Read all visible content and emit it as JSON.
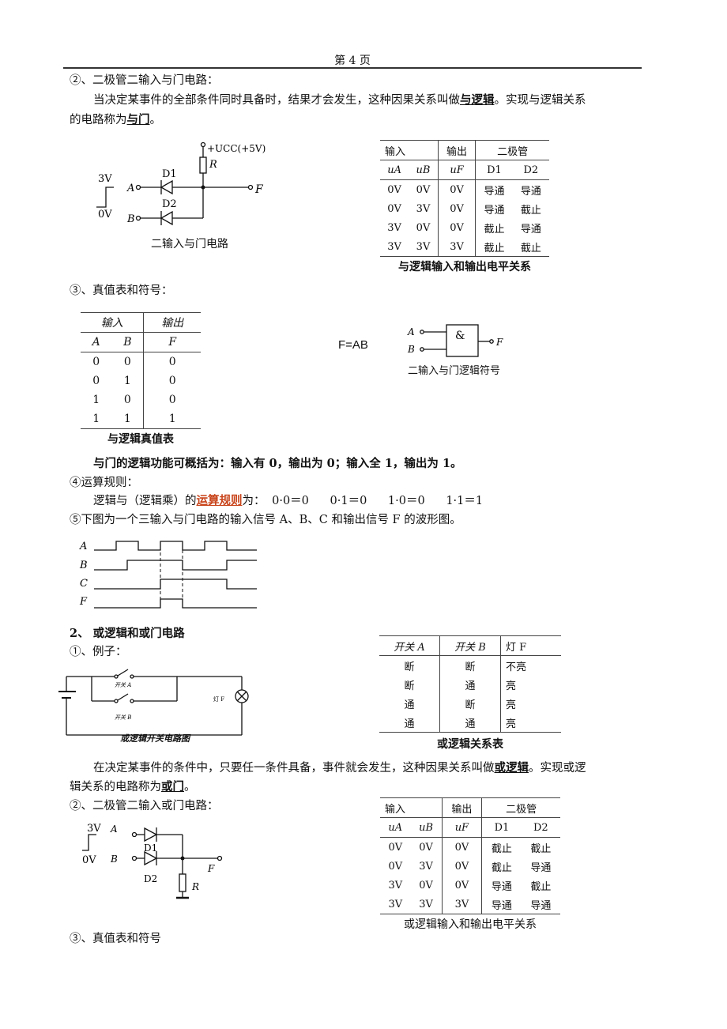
{
  "header": {
    "page_label": "第 4 页"
  },
  "and_section": {
    "item2_heading": "②、二极管二输入与门电路：",
    "para1_a": "当决定某事件的全部条件同时具备时，结果才会发生，这种因果关系叫做",
    "para1_term": "与逻辑",
    "para1_b": "。实现与逻辑关系",
    "para2_a": "的电路称为",
    "para2_term": "与门",
    "para2_b": "。",
    "circuit": {
      "caption": "二输入与门电路",
      "vcc_label": "+UCC(+5V)",
      "r_label": "R",
      "d1_label": "D1",
      "d2_label": "D2",
      "input_a": "A",
      "input_b": "B",
      "output_f": "F",
      "high_level": "3V",
      "low_level": "0V"
    },
    "level_table": {
      "headers": [
        "输入",
        "输出",
        "二极管"
      ],
      "subheaders": [
        "uA",
        "uB",
        "uF",
        "D1",
        "D2"
      ],
      "rows": [
        [
          "0V",
          "0V",
          "0V",
          "导通",
          "导通"
        ],
        [
          "0V",
          "3V",
          "0V",
          "导通",
          "截止"
        ],
        [
          "3V",
          "0V",
          "0V",
          "截止",
          "导通"
        ],
        [
          "3V",
          "3V",
          "3V",
          "截止",
          "截止"
        ]
      ],
      "caption": "与逻辑输入和输出电平关系"
    },
    "item3_heading": "③、真值表和符号：",
    "truth_table": {
      "headers": [
        "输入",
        "输出"
      ],
      "subheaders": [
        "A",
        "B",
        "F"
      ],
      "rows": [
        [
          "0",
          "0",
          "0"
        ],
        [
          "0",
          "1",
          "0"
        ],
        [
          "1",
          "0",
          "0"
        ],
        [
          "1",
          "1",
          "1"
        ]
      ],
      "caption": "与逻辑真值表"
    },
    "expression": "F=AB",
    "symbol": {
      "gate_label": "&",
      "input_a": "A",
      "input_b": "B",
      "output": "F",
      "caption": "二输入与门逻辑符号"
    },
    "summary": "与门的逻辑功能可概括为：输入有 0，输出为 0；输入全 1，输出为 1。",
    "item4_heading": "④运算规则：",
    "rule_prefix": "逻辑与（逻辑乘）的",
    "rule_link": "运算规则",
    "rule_suffix": "为：",
    "rules": [
      "0·0＝0",
      "0·1＝0",
      "1·0＝0",
      "1·1＝1"
    ],
    "item5_heading": "⑤下图为一个三输入与门电路的输入信号 A、B、C 和输出信号 F 的波形图。",
    "waveform": {
      "signals": [
        "A",
        "B",
        "C",
        "F"
      ]
    }
  },
  "or_section": {
    "title": "2、 或逻辑和或门电路",
    "item1_heading": "①、例子：",
    "switch_circuit": {
      "switch_a": "开关 A",
      "switch_b": "开关 B",
      "lamp": "灯 F",
      "caption": "或逻辑开关电路图"
    },
    "switch_table": {
      "headers": [
        "开关 A",
        "开关 B",
        "灯 F"
      ],
      "rows": [
        [
          "断",
          "断",
          "不亮"
        ],
        [
          "断",
          "通",
          "亮"
        ],
        [
          "通",
          "断",
          "亮"
        ],
        [
          "通",
          "通",
          "亮"
        ]
      ],
      "caption": "或逻辑关系表"
    },
    "para1_a": "在决定某事件的条件中，只要任一条件具备，事件就会发生，这种因果关系叫做",
    "para1_term": "或逻辑",
    "para1_b": "。实现或逻",
    "para2_a": "辑关系的电路称为",
    "para2_term": "或门",
    "para2_b": "。",
    "item2_heading": "②、二极管二输入或门电路：",
    "circuit": {
      "high_level": "3V",
      "low_level": "0V",
      "input_a": "A",
      "input_b": "B",
      "d1_label": "D1",
      "d2_label": "D2",
      "output_f": "F",
      "r_label": "R"
    },
    "level_table": {
      "headers": [
        "输入",
        "输出",
        "二极管"
      ],
      "subheaders": [
        "uA",
        "uB",
        "uF",
        "D1",
        "D2"
      ],
      "rows": [
        [
          "0V",
          "0V",
          "0V",
          "截止",
          "截止"
        ],
        [
          "0V",
          "3V",
          "0V",
          "截止",
          "导通"
        ],
        [
          "3V",
          "0V",
          "0V",
          "导通",
          "截止"
        ],
        [
          "3V",
          "3V",
          "3V",
          "导通",
          "导通"
        ]
      ],
      "caption": "或逻辑输入和输出电平关系"
    },
    "item3_heading": "③、真值表和符号"
  },
  "colors": {
    "link": "#c8431a",
    "rule": "#333333",
    "text": "#111111"
  }
}
